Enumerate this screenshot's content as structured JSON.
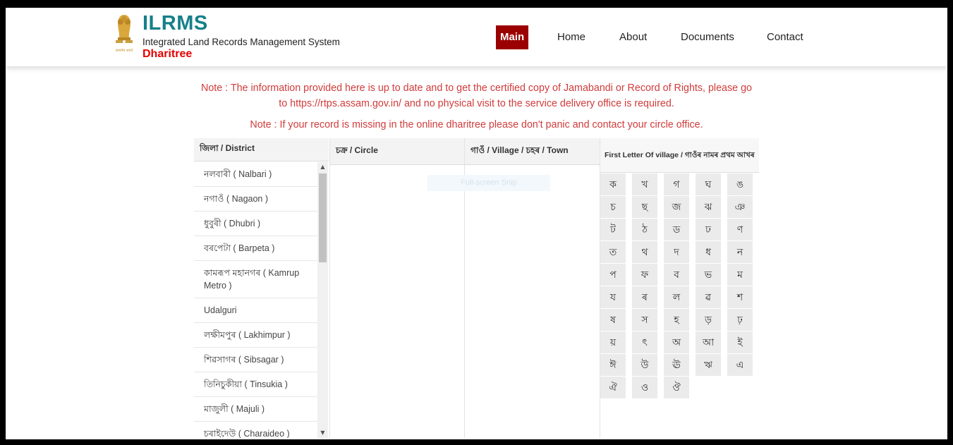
{
  "header": {
    "title": "ILRMS",
    "subtitle": "Integrated Land Records Management System",
    "name": "Dharitree",
    "emblem_text": "सत्यमेव जयते"
  },
  "nav": {
    "items": [
      {
        "label": "Main",
        "active": true
      },
      {
        "label": "Home"
      },
      {
        "label": "About"
      },
      {
        "label": "Documents"
      },
      {
        "label": "Contact"
      }
    ]
  },
  "notes": {
    "note1_line1": "Note : The information provided here is up to date and to get the certified copy of Jamabandi or Record of Rights, please go",
    "note1_line2": "to https://rtps.assam.gov.in/ and no physical visit to the service delivery office is required.",
    "note2": "Note : If your record is missing in the online dharitree please don't panic and contact your circle office."
  },
  "columns": {
    "district": "জিলা / District",
    "circle": "চক্ৰ / Circle",
    "village": "গাওঁ / Village / চহৰ / Town",
    "letter": "First Letter Of village / গাওঁৰ নামৰ প্ৰথম আখৰ"
  },
  "districts": [
    "নলবাৰী ( Nalbari )",
    "নগাওঁ ( Nagaon )",
    "ধুবুৰী ( Dhubri )",
    "বৰপেটা ( Barpeta )",
    "কামৰূপ মহানগৰ ( Kamrup Metro )",
    "Udalguri",
    "লক্ষীমপুৰ ( Lakhimpur )",
    "শিৱসাগৰ ( Sibsagar )",
    "তিনিচুকীয়া ( Tinsukia )",
    "মাজুলী ( Majuli )",
    "চৰাইদেউ ( Charaideo )"
  ],
  "overlay": {
    "snip": "Full-screen Snip"
  },
  "letters": [
    "ক",
    "খ",
    "গ",
    "ঘ",
    "ঙ",
    "চ",
    "ছ",
    "জ",
    "ঝ",
    "ঞ",
    "ট",
    "ঠ",
    "ড",
    "ঢ",
    "ণ",
    "ত",
    "থ",
    "দ",
    "ধ",
    "ন",
    "প",
    "ফ",
    "ব",
    "ভ",
    "ম",
    "য",
    "ৰ",
    "ল",
    "ৱ",
    "শ",
    "ষ",
    "স",
    "হ",
    "ড়",
    "ঢ়",
    "য়",
    "ৎ",
    "অ",
    "আ",
    "ই",
    "ঈ",
    "উ",
    "ঊ",
    "ঋ",
    "এ",
    "ঐ",
    "ও",
    "ঔ"
  ],
  "colors": {
    "brand": "#167f89",
    "accent_red": "#9b0000",
    "name_red": "#e50000",
    "note_red": "#d13b3b"
  }
}
